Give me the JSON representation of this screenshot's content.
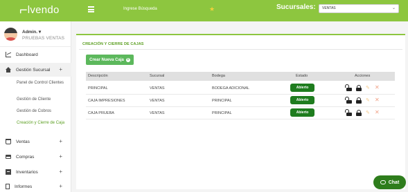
{
  "header": {
    "logo_text": "lvendo",
    "search_label": "Ingrese Búsqueda",
    "sucursales_label": "Sucursales:",
    "sucursal_selected": "VENTAS"
  },
  "sidebar": {
    "user_name": "Admin.",
    "user_role": "PRUEBAS VENTAS",
    "items": [
      {
        "label": "Dashboard"
      },
      {
        "label": "Gestión Sucursal"
      },
      {
        "label": "Ventas"
      },
      {
        "label": "Compras"
      },
      {
        "label": "Inventarios"
      },
      {
        "label": "Informes"
      }
    ],
    "subitems": [
      {
        "label": "Panel de Control Clientes"
      },
      {
        "label": "Gestión de Cliente"
      },
      {
        "label": "Gestión de Cobros"
      },
      {
        "label": "Creación y Cierre de Caja"
      }
    ]
  },
  "main": {
    "title": "CREACIÓN Y CIERRE DE CAJAS",
    "new_button": "Crear Nueva Caja",
    "columns": [
      "Descripción",
      "Sucursal",
      "Bodega",
      "Estado",
      "Acciones"
    ],
    "rows": [
      {
        "descripcion": "PRINCIPAL",
        "sucursal": "VENTAS",
        "bodega": "BODEGA ADICIONAL",
        "estado": "Abierto"
      },
      {
        "descripcion": "CAJA IMPRESIONES",
        "sucursal": "VENTAS",
        "bodega": "PRINCIPAL",
        "estado": "Abierto"
      },
      {
        "descripcion": "CAJA PRUEBA",
        "sucursal": "VENTAS",
        "bodega": "PRINCIPAL",
        "estado": "Abierto"
      }
    ]
  },
  "chat": {
    "label": "Chat"
  },
  "colors": {
    "brand": "#8dc63f",
    "accent_dark": "#1e7c1e",
    "button": "#5cb85c"
  }
}
